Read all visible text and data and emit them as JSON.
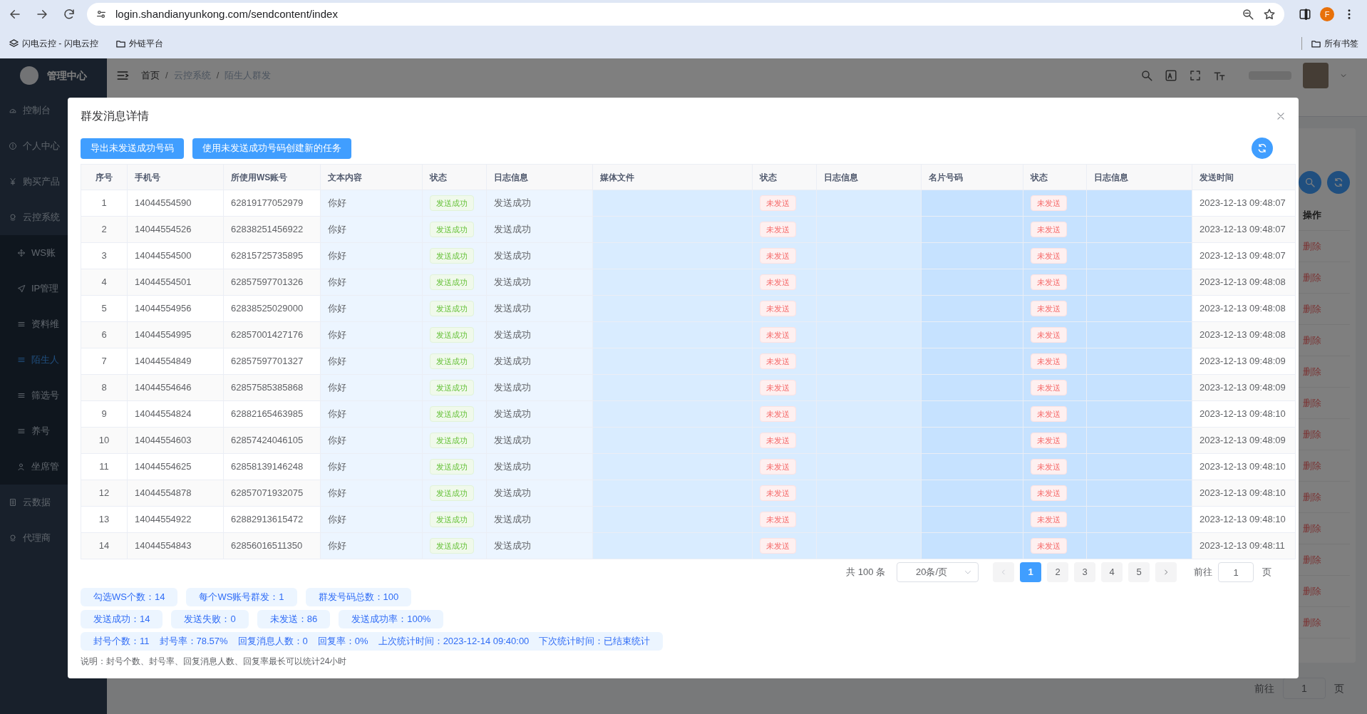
{
  "browser": {
    "url": "login.shandianyunkong.com/sendcontent/index",
    "profile": "F",
    "bookmarks": [
      {
        "kind": "site",
        "label": "闪电云控 - 闪电云控"
      },
      {
        "kind": "folder",
        "label": "外链平台"
      }
    ],
    "all_bookmarks": "所有书签"
  },
  "sidebar": {
    "brand": "管理中心",
    "items": [
      {
        "label": "控制台",
        "selected": false
      },
      {
        "label": "个人中心",
        "selected": false
      },
      {
        "label": "购买产品",
        "selected": false
      },
      {
        "label": "云控系统",
        "selected": false,
        "expanded": true,
        "children": [
          {
            "label": "WS账",
            "selected": false
          },
          {
            "label": "IP管理",
            "selected": false
          },
          {
            "label": "资料维",
            "selected": false
          },
          {
            "label": "陌生人",
            "selected": true
          },
          {
            "label": "筛选号",
            "selected": false
          },
          {
            "label": "养号",
            "selected": false
          },
          {
            "label": "坐席管",
            "selected": false
          }
        ]
      },
      {
        "label": "云数据",
        "selected": false
      },
      {
        "label": "代理商",
        "selected": false
      }
    ]
  },
  "header": {
    "breadcrumb": [
      "首页",
      "/",
      "云控系统",
      "/",
      "陌生人群发"
    ]
  },
  "background": {
    "action_header": "操作",
    "delete_links": [
      "删除",
      "删除",
      "删除",
      "删除",
      "删除",
      "删除",
      "删除",
      "删除",
      "删除",
      "删除",
      "删除",
      "删除",
      "删除"
    ],
    "goto": "前往",
    "page_input": "1",
    "page_suffix": "页"
  },
  "dialog": {
    "title": "群发消息详情",
    "buttons": [
      "导出未发送成功号码",
      "使用未发送成功号码创建新的任务"
    ],
    "table": {
      "columns": [
        "序号",
        "手机号",
        "所使用WS账号",
        "文本内容",
        "状态",
        "日志信息",
        "媒体文件",
        "状态",
        "日志信息",
        "名片号码",
        "状态",
        "日志信息",
        "发送时间"
      ],
      "rows": [
        {
          "no": "1",
          "phone": "14044554590",
          "ws": "62819177052979",
          "text": "你好",
          "statuses": [
            {
              "label": "发送成功",
              "kind": "success"
            },
            {
              "label": "未发送",
              "kind": "danger"
            },
            {
              "label": "未发送",
              "kind": "danger"
            }
          ],
          "log": "发送成功",
          "time": "2023-12-13 09:48:07"
        },
        {
          "no": "2",
          "phone": "14044554526",
          "ws": "62838251456922",
          "text": "你好",
          "statuses": [
            {
              "label": "发送成功",
              "kind": "success"
            },
            {
              "label": "未发送",
              "kind": "danger"
            },
            {
              "label": "未发送",
              "kind": "danger"
            }
          ],
          "log": "发送成功",
          "time": "2023-12-13 09:48:07"
        },
        {
          "no": "3",
          "phone": "14044554500",
          "ws": "62815725735895",
          "text": "你好",
          "statuses": [
            {
              "label": "发送成功",
              "kind": "success"
            },
            {
              "label": "未发送",
              "kind": "danger"
            },
            {
              "label": "未发送",
              "kind": "danger"
            }
          ],
          "log": "发送成功",
          "time": "2023-12-13 09:48:07"
        },
        {
          "no": "4",
          "phone": "14044554501",
          "ws": "62857597701326",
          "text": "你好",
          "statuses": [
            {
              "label": "发送成功",
              "kind": "success"
            },
            {
              "label": "未发送",
              "kind": "danger"
            },
            {
              "label": "未发送",
              "kind": "danger"
            }
          ],
          "log": "发送成功",
          "time": "2023-12-13 09:48:08"
        },
        {
          "no": "5",
          "phone": "14044554956",
          "ws": "62838525029000",
          "text": "你好",
          "statuses": [
            {
              "label": "发送成功",
              "kind": "success"
            },
            {
              "label": "未发送",
              "kind": "danger"
            },
            {
              "label": "未发送",
              "kind": "danger"
            }
          ],
          "log": "发送成功",
          "time": "2023-12-13 09:48:08"
        },
        {
          "no": "6",
          "phone": "14044554995",
          "ws": "62857001427176",
          "text": "你好",
          "statuses": [
            {
              "label": "发送成功",
              "kind": "success"
            },
            {
              "label": "未发送",
              "kind": "danger"
            },
            {
              "label": "未发送",
              "kind": "danger"
            }
          ],
          "log": "发送成功",
          "time": "2023-12-13 09:48:08"
        },
        {
          "no": "7",
          "phone": "14044554849",
          "ws": "62857597701327",
          "text": "你好",
          "statuses": [
            {
              "label": "发送成功",
              "kind": "success"
            },
            {
              "label": "未发送",
              "kind": "danger"
            },
            {
              "label": "未发送",
              "kind": "danger"
            }
          ],
          "log": "发送成功",
          "time": "2023-12-13 09:48:09"
        },
        {
          "no": "8",
          "phone": "14044554646",
          "ws": "62857585385868",
          "text": "你好",
          "statuses": [
            {
              "label": "发送成功",
              "kind": "success"
            },
            {
              "label": "未发送",
              "kind": "danger"
            },
            {
              "label": "未发送",
              "kind": "danger"
            }
          ],
          "log": "发送成功",
          "time": "2023-12-13 09:48:09"
        },
        {
          "no": "9",
          "phone": "14044554824",
          "ws": "62882165463985",
          "text": "你好",
          "statuses": [
            {
              "label": "发送成功",
              "kind": "success"
            },
            {
              "label": "未发送",
              "kind": "danger"
            },
            {
              "label": "未发送",
              "kind": "danger"
            }
          ],
          "log": "发送成功",
          "time": "2023-12-13 09:48:10"
        },
        {
          "no": "10",
          "phone": "14044554603",
          "ws": "62857424046105",
          "text": "你好",
          "statuses": [
            {
              "label": "发送成功",
              "kind": "success"
            },
            {
              "label": "未发送",
              "kind": "danger"
            },
            {
              "label": "未发送",
              "kind": "danger"
            }
          ],
          "log": "发送成功",
          "time": "2023-12-13 09:48:09"
        },
        {
          "no": "11",
          "phone": "14044554625",
          "ws": "62858139146248",
          "text": "你好",
          "statuses": [
            {
              "label": "发送成功",
              "kind": "success"
            },
            {
              "label": "未发送",
              "kind": "danger"
            },
            {
              "label": "未发送",
              "kind": "danger"
            }
          ],
          "log": "发送成功",
          "time": "2023-12-13 09:48:10"
        },
        {
          "no": "12",
          "phone": "14044554878",
          "ws": "62857071932075",
          "text": "你好",
          "statuses": [
            {
              "label": "发送成功",
              "kind": "success"
            },
            {
              "label": "未发送",
              "kind": "danger"
            },
            {
              "label": "未发送",
              "kind": "danger"
            }
          ],
          "log": "发送成功",
          "time": "2023-12-13 09:48:10"
        },
        {
          "no": "13",
          "phone": "14044554922",
          "ws": "62882913615472",
          "text": "你好",
          "statuses": [
            {
              "label": "发送成功",
              "kind": "success"
            },
            {
              "label": "未发送",
              "kind": "danger"
            },
            {
              "label": "未发送",
              "kind": "danger"
            }
          ],
          "log": "发送成功",
          "time": "2023-12-13 09:48:10"
        },
        {
          "no": "14",
          "phone": "14044554843",
          "ws": "62856016511350",
          "text": "你好",
          "statuses": [
            {
              "label": "发送成功",
              "kind": "success"
            },
            {
              "label": "未发送",
              "kind": "danger"
            },
            {
              "label": "未发送",
              "kind": "danger"
            }
          ],
          "log": "发送成功",
          "time": "2023-12-13 09:48:11"
        }
      ]
    },
    "pagination": {
      "total": "共 100 条",
      "page_size": "20条/页",
      "pages": [
        {
          "label": "1",
          "selected": true
        },
        {
          "label": "2",
          "selected": false
        },
        {
          "label": "3",
          "selected": false
        },
        {
          "label": "4",
          "selected": false
        },
        {
          "label": "5",
          "selected": false
        }
      ],
      "goto": "前往",
      "page_input": "1",
      "page_suffix": "页"
    },
    "stats": [
      [
        "勾选WS个数：14",
        "每个WS账号群发：1",
        "群发号码总数：100"
      ],
      [
        "发送成功：14",
        "发送失败：0",
        "未发送：86",
        "发送成功率：100%"
      ]
    ],
    "summary": [
      "封号个数：11",
      "封号率：78.57%",
      "回复消息人数：0",
      "回复率：0%",
      "上次统计时间：2023-12-14 09:40:00",
      "下次统计时间：已结束统计"
    ],
    "note": "说明：封号个数、封号率、回复消息人数、回复率最长可以统计24小时"
  }
}
